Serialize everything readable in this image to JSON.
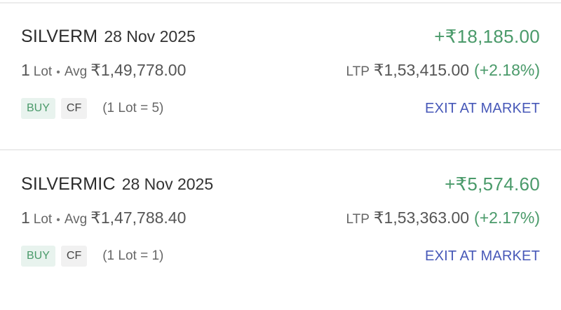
{
  "positions": [
    {
      "symbol": "SILVERM",
      "expiry": "28 Nov 2025",
      "pnl": "+₹18,185.00",
      "quantity": "1",
      "quantity_unit": "Lot",
      "separator": "•",
      "avg_label": "Avg",
      "avg_price": "₹1,49,778.00",
      "ltp_label": "LTP",
      "ltp": "₹1,53,415.00",
      "ltp_change": "(+2.18%)",
      "tags": [
        "BUY",
        "CF"
      ],
      "lot_size": "(1 Lot = 5)",
      "exit_label": "EXIT AT MARKET"
    },
    {
      "symbol": "SILVERMIC",
      "expiry": "28 Nov 2025",
      "pnl": "+₹5,574.60",
      "quantity": "1",
      "quantity_unit": "Lot",
      "separator": "•",
      "avg_label": "Avg",
      "avg_price": "₹1,47,788.40",
      "ltp_label": "LTP",
      "ltp": "₹1,53,363.00",
      "ltp_change": "(+2.17%)",
      "tags": [
        "BUY",
        "CF"
      ],
      "lot_size": "(1 Lot = 1)",
      "exit_label": "EXIT AT MARKET"
    }
  ],
  "colors": {
    "profit": "#4a9a6a",
    "link": "#4758b8",
    "buy_tag_bg": "#e8f3ee",
    "cf_tag_bg": "#f1f1f1",
    "divider": "#ececec"
  }
}
